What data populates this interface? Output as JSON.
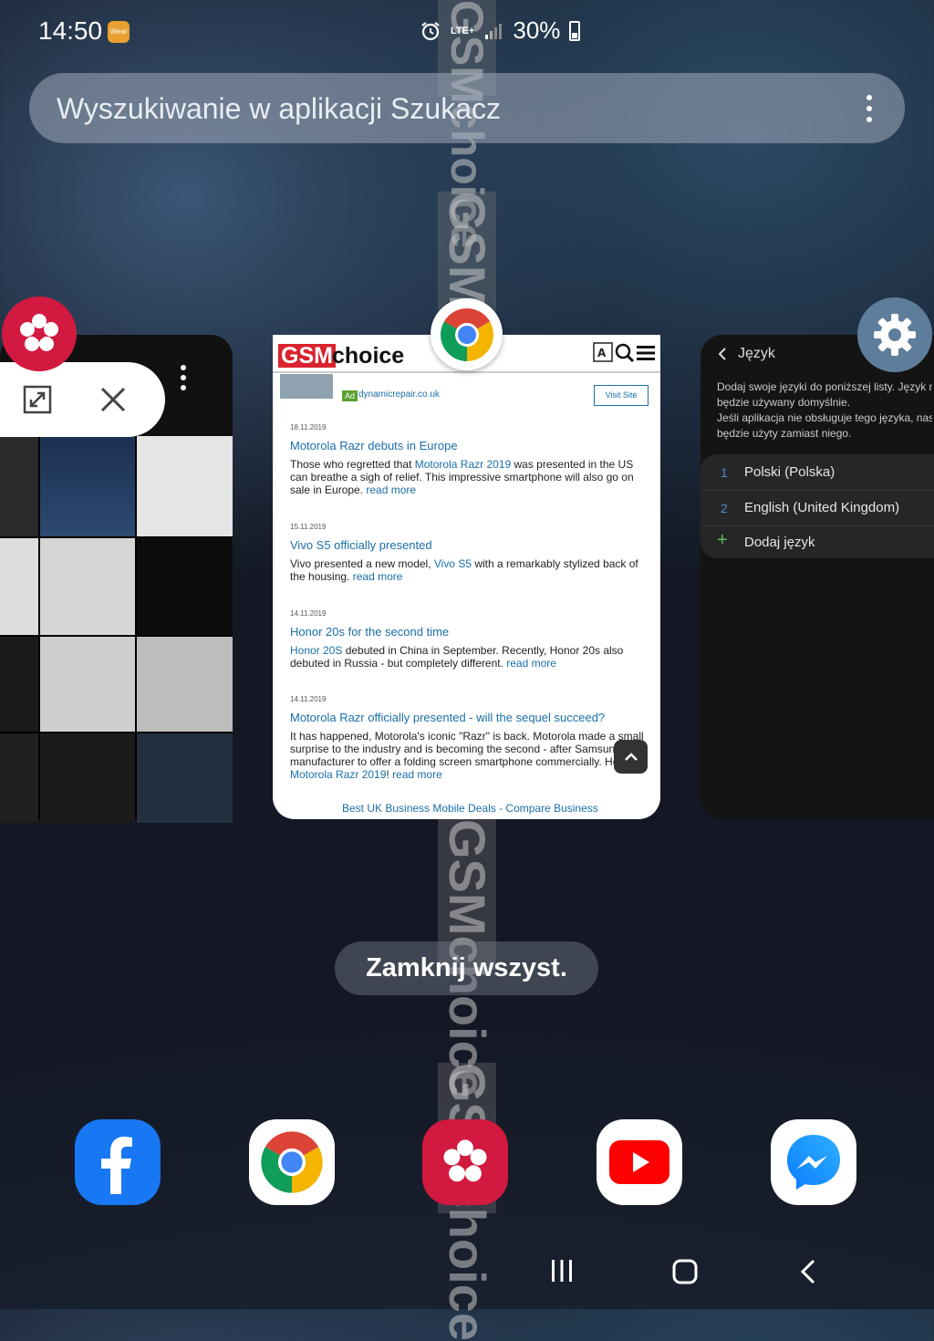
{
  "status_bar": {
    "time": "14:50",
    "wear_badge": "Wear",
    "network": "LTE+",
    "battery": "30%"
  },
  "search": {
    "placeholder": "Wyszukiwanie w aplikacji Szukacz"
  },
  "recent_apps": {
    "gallery_card": {
      "icon": "flower-icon"
    },
    "chrome_card": {
      "site_logo_red": "GSM",
      "site_logo_black": "choice",
      "ad_domain": "dynamicrepair.co.uk",
      "ad_badge": "Ad",
      "visit_button": "Visit Site",
      "news": [
        {
          "date": "18.11.2019",
          "title": "Motorola Razr debuts in Europe",
          "body_pre": "Those who regretted that ",
          "body_link": "Motorola Razr 2019",
          "body_post": " was presented in the US can breathe a sigh of relief. This impressive smartphone will also go on sale in Europe. ",
          "read_more": "read more"
        },
        {
          "date": "15.11.2019",
          "title": "Vivo S5 officially presented",
          "body_pre": "Vivo presented a new model, ",
          "body_link": "Vivo S5",
          "body_post": " with a remarkably stylized back of the housing. ",
          "read_more": "read more"
        },
        {
          "date": "14.11.2019",
          "title": "Honor 20s for the second time",
          "body_pre": "",
          "body_link": "Honor 20S",
          "body_post": " debuted in China in September. Recently, Honor 20s also debuted in Russia - but completely different. ",
          "read_more": "read more"
        },
        {
          "date": "14.11.2019",
          "title": "Motorola Razr officially presented - will the sequel succeed?",
          "body_pre": "It has happened, Motorola's iconic \"Razr\" is back. Motorola made a small surprise to the industry and is becoming the second - after Samsung - manufacturer to offer a folding screen smartphone commercially. Here is ",
          "body_link": "Motorola Razr 2019",
          "body_post": "! ",
          "read_more": "read more"
        }
      ],
      "bottom_ad": "Best UK Business Mobile Deals - Compare Business"
    },
    "settings_card": {
      "title": "Język",
      "description_1": "Dodaj swoje języki do poniższej listy. Język na górze będzie używany domyślnie.",
      "description_2": "Jeśli aplikacja nie obsługuje tego języka, następny język będzie użyty zamiast niego.",
      "languages": [
        {
          "num": "1",
          "name": "Polski (Polska)"
        },
        {
          "num": "2",
          "name": "English (United Kingdom)"
        }
      ],
      "add_language": "Dodaj język"
    }
  },
  "close_all": "Zamknij wszyst.",
  "dock": [
    "facebook-icon",
    "chrome-icon",
    "gallery-icon",
    "youtube-icon",
    "messenger-icon"
  ],
  "watermark": "GSMchoice"
}
